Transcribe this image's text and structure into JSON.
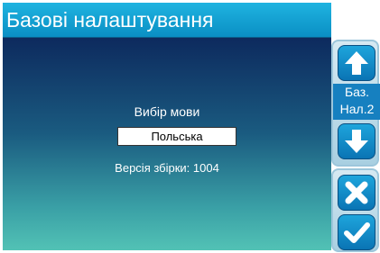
{
  "header": {
    "title": "Базові налаштування"
  },
  "settings": {
    "language_label": "Вибір мови",
    "language_value": "Польська",
    "build_version": "Версія збірки: 1004"
  },
  "side_panel": {
    "page_label_line1": "Баз.",
    "page_label_line2": "Нал.2",
    "up_icon": "arrow-up-icon",
    "down_icon": "arrow-down-icon",
    "cancel_icon": "close-icon",
    "ok_icon": "check-icon"
  },
  "colors": {
    "title_bar": "#0a9fd6",
    "button": "#0f8ccc",
    "panel_frame": "#9cc6db"
  }
}
